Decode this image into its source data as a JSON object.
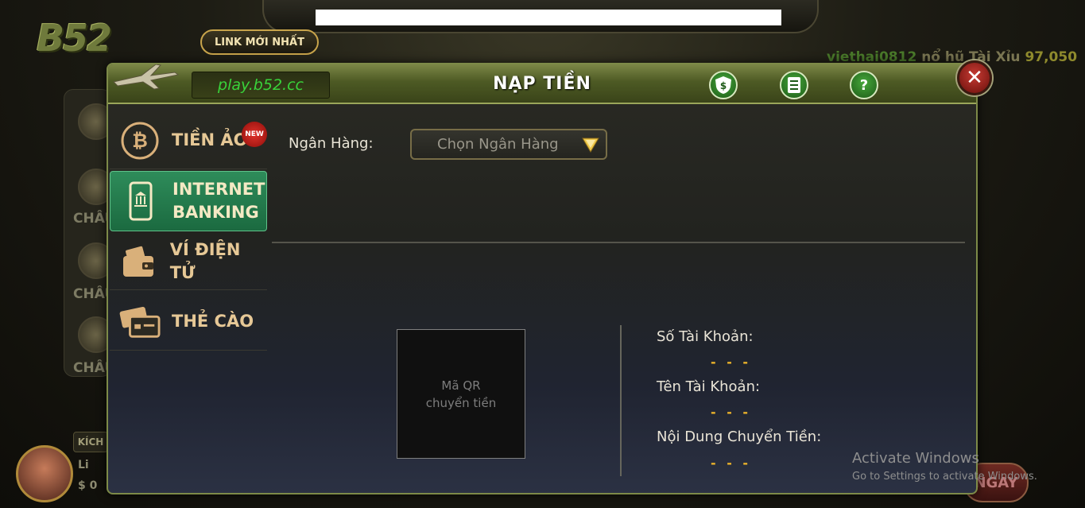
{
  "background": {
    "logo_text": "B52",
    "link_button_label": "LINK MỚI NHẤT",
    "ticker": {
      "user": "viethai0812",
      "message": "nổ hũ Tài Xỉu",
      "amount": "97,050"
    },
    "left_labels": [
      "CHÂU",
      "CHÂU",
      "CHÂU"
    ],
    "kich_label": "KÍCH",
    "player_line1": "Li",
    "player_line2": "$ 0",
    "right_button_label": "NGAY"
  },
  "modal": {
    "url": "play.b52.cc",
    "title": "NẠP TIỀN",
    "header_icons": [
      "money-shield-icon",
      "document-icon",
      "help-icon"
    ],
    "help_symbol": "?",
    "money_symbol": "$",
    "close_symbol": "✕"
  },
  "sidebar": {
    "items": [
      {
        "label": "TIỀN ẢO",
        "icon": "bitcoin-icon",
        "badge": "NEW",
        "active": false
      },
      {
        "label_line1": "INTERNET",
        "label_line2": "BANKING",
        "icon": "mobile-bank-icon",
        "active": true
      },
      {
        "label": "VÍ ĐIỆN TỬ",
        "icon": "wallet-icon",
        "active": false
      },
      {
        "label": "THẺ CÀO",
        "icon": "card-icon",
        "active": false
      }
    ]
  },
  "form": {
    "bank_label": "Ngân Hàng:",
    "bank_select_value": "Chọn Ngân Hàng"
  },
  "details": {
    "qr_line1": "Mã QR",
    "qr_line2": "chuyển tiền",
    "account_number_label": "Số Tài Khoản:",
    "account_number_value": "- - -",
    "account_name_label": "Tên Tài Khoản:",
    "account_name_value": "- - -",
    "transfer_content_label": "Nội Dung Chuyển Tiền:",
    "transfer_content_value": "- - -"
  },
  "windows_watermark": {
    "line1": "Activate Windows",
    "line2": "Go to Settings to activate Windows."
  },
  "colors": {
    "accent_green": "#1b6a40",
    "gold": "#f0b62a",
    "header_olive": "#4d5a24",
    "close_red": "#c63b33"
  }
}
